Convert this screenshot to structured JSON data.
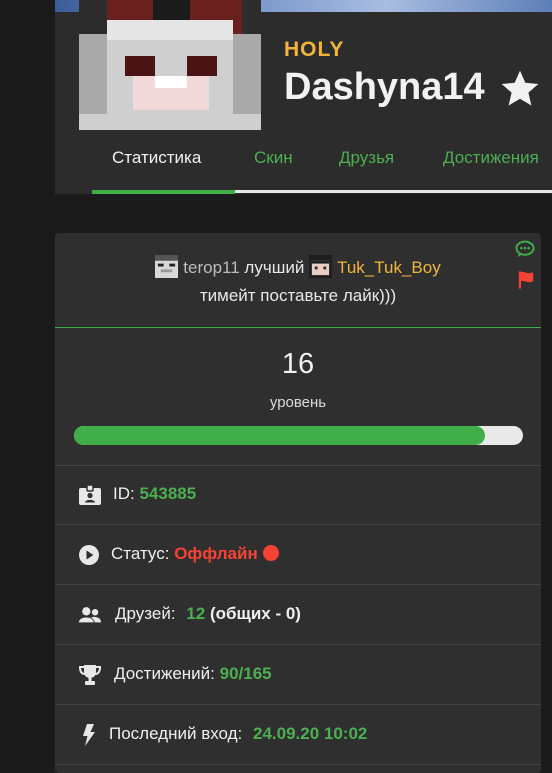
{
  "profile": {
    "rank": "HOLY",
    "nickname": "Dashyna14"
  },
  "tabs": [
    {
      "label": "Статистика",
      "active": true
    },
    {
      "label": "Скин",
      "active": false
    },
    {
      "label": "Друзья",
      "active": false
    },
    {
      "label": "Достижения",
      "active": false
    }
  ],
  "status_message": {
    "user1": "terop11",
    "middle": "лучший",
    "user2": "Tuk_Tuk_Boy",
    "line2": "тимейт  поставьте лайк)))"
  },
  "level": {
    "value": "16",
    "label": "уровень",
    "progress_fraction": 0.915
  },
  "stats": {
    "id_label": "ID:",
    "id_value": "543885",
    "status_label": "Статус:",
    "status_value": "Оффлайн",
    "friends_label": "Друзей:",
    "friends_value": "12",
    "friends_common": "(общих - 0)",
    "achievements_label": "Достижений:",
    "achievements_value": "90/165",
    "last_login_label": "Последний вход:",
    "last_login_value": "24.09.20 10:02"
  },
  "colors": {
    "accent_green": "#3fae49",
    "rank_gold": "#f4b43a",
    "offline_red": "#f44336",
    "card_bg": "#2f2f2f"
  },
  "icons": [
    "star-icon",
    "comment-icon",
    "flag-icon",
    "id-card-icon",
    "play-circle-icon",
    "users-icon",
    "trophy-icon",
    "bolt-icon"
  ]
}
